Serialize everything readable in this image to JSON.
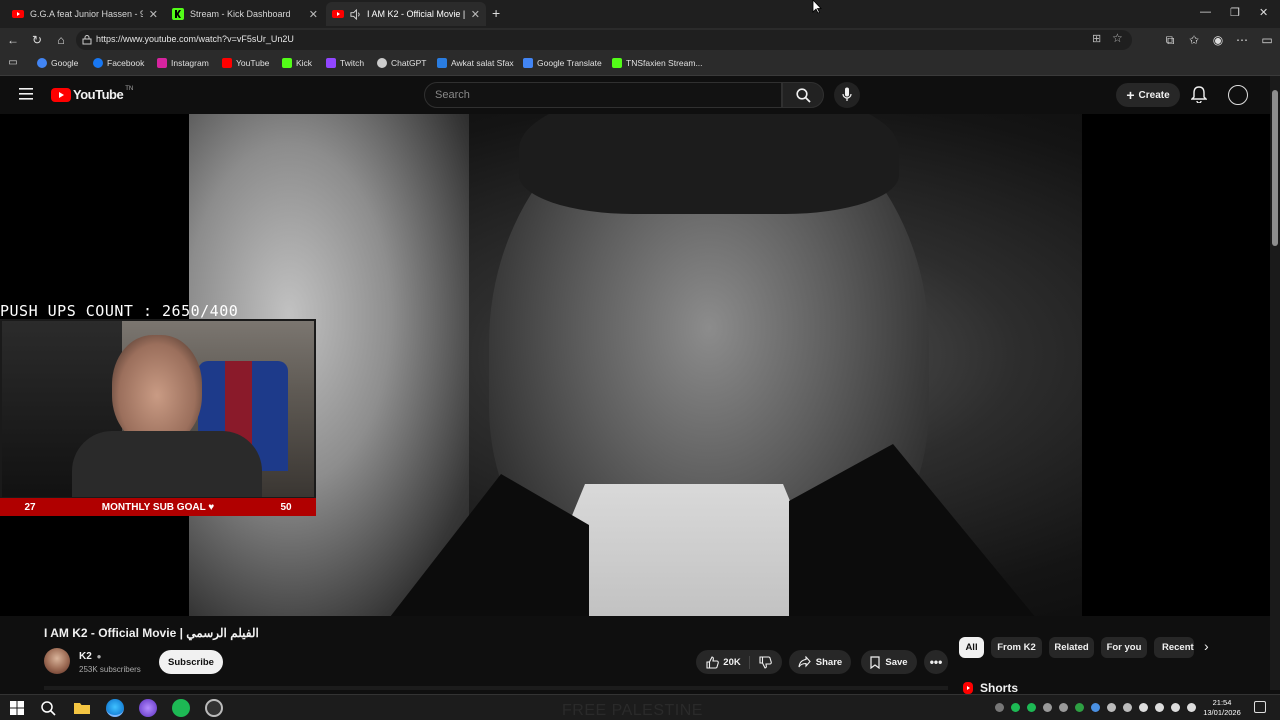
{
  "browser": {
    "tabs": [
      {
        "title": "G.G.A feat Junior Hassen - 9anoun",
        "favicon": "youtube-icon"
      },
      {
        "title": "Stream - Kick Dashboard",
        "favicon": "kick-icon"
      },
      {
        "title": "I AM K2 - Official Movie | الفيلم الرسمي",
        "favicon": "youtube-icon",
        "active": true
      }
    ],
    "url": "https://www.youtube.com/watch?v=vF5sUr_Un2U",
    "bookmarks": [
      "Google",
      "Facebook",
      "Instagram",
      "YouTube",
      "Kick",
      "Twitch",
      "ChatGPT",
      "Awkat salat Sfax",
      "Google Translate",
      "TNSfaxien Stream..."
    ]
  },
  "youtube": {
    "logo_text": "YouTube",
    "logo_sup": "TN",
    "search_placeholder": "Search",
    "create_label": "Create"
  },
  "overlay": {
    "pushups": "PUSH UPS COUNT : 2650/400",
    "subgoal_current": "27",
    "subgoal_label": "MONTHLY SUB GOAL ♥",
    "subgoal_target": "50"
  },
  "video": {
    "title": "I AM K2 - Official Movie | الفيلم الرسمي",
    "channel": "K2",
    "subscribers": "253K subscribers",
    "subscribe_label": "Subscribe",
    "likes": "20K",
    "share_label": "Share",
    "save_label": "Save"
  },
  "chips": [
    "All",
    "From K2",
    "Related",
    "For you",
    "Recent"
  ],
  "shorts_label": "Shorts",
  "background_text": "FREE PALESTINE",
  "clock": {
    "time": "21:54",
    "date": "13/01/2026"
  },
  "colors": {
    "youtube_red": "#ff0000",
    "kick_green": "#53fc18",
    "goal_red": "#b00000"
  }
}
